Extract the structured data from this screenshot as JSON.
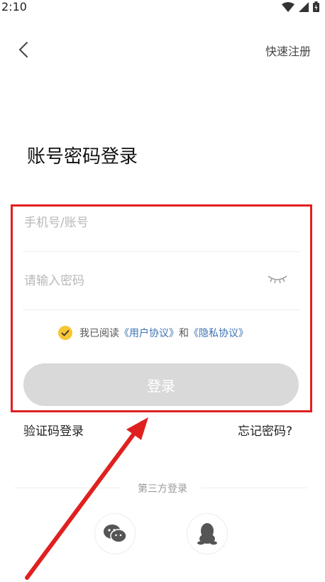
{
  "status_bar": {
    "time": "2:10"
  },
  "header": {
    "quick_register": "快速注册"
  },
  "title": "账号密码登录",
  "form": {
    "account_placeholder": "手机号/账号",
    "password_placeholder": "请输入密码",
    "agreement": {
      "prefix": "我已阅读",
      "user_agreement": "《用户协议》",
      "and": "和",
      "privacy_agreement": "《隐私协议》"
    },
    "login_label": "登录"
  },
  "links": {
    "sms_login": "验证码登录",
    "forgot_password": "忘记密码?"
  },
  "third_party": {
    "label": "第三方登录",
    "icons": [
      "wechat-icon",
      "qq-icon"
    ]
  },
  "colors": {
    "accent_check": "#f7c634",
    "link": "#3c72b2",
    "highlight": "#e02020"
  }
}
